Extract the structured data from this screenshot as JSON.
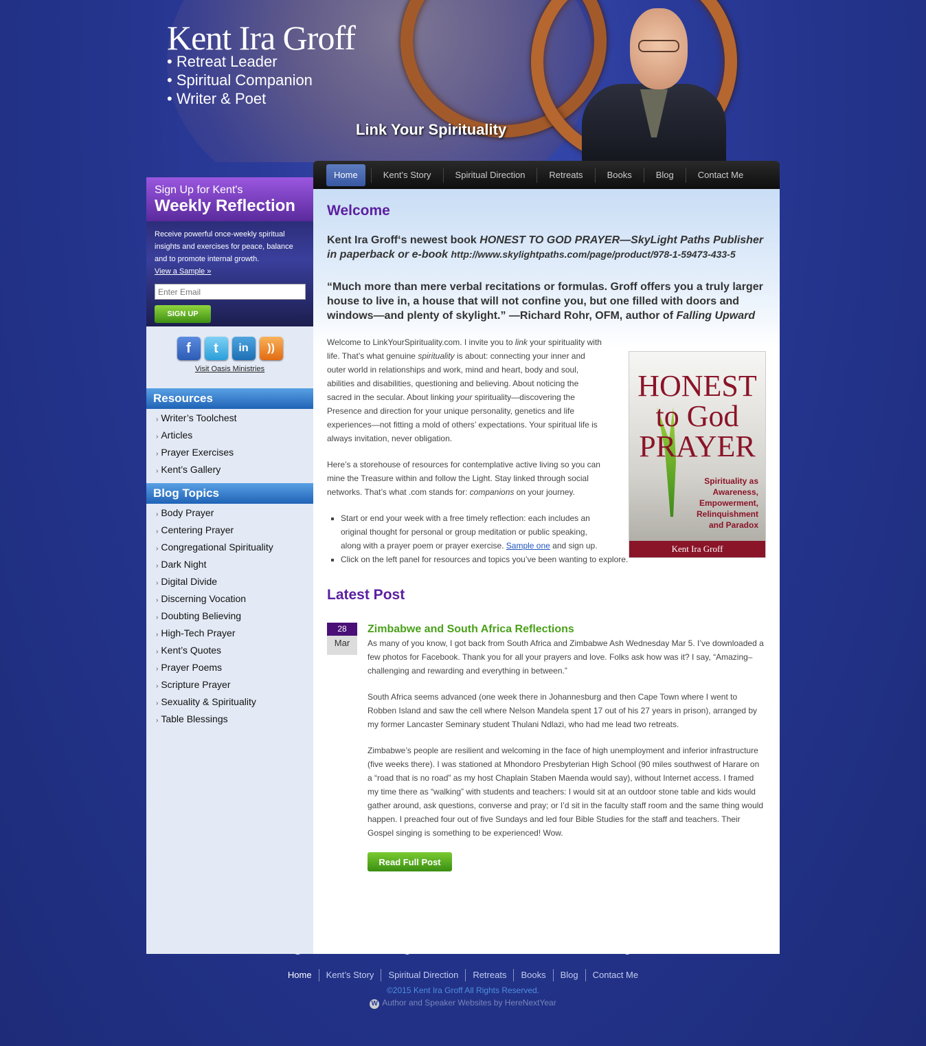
{
  "header": {
    "title": "Kent Ira Groff",
    "roles": [
      "• Retreat Leader",
      "• Spiritual Companion",
      "• Writer & Poet"
    ],
    "tagline": "Link Your Spirituality"
  },
  "nav": {
    "items": [
      "Home",
      "Kent’s Story",
      "Spiritual Direction",
      "Retreats",
      "Books",
      "Blog",
      "Contact Me"
    ],
    "active": "Home"
  },
  "signup": {
    "small": "Sign Up for Kent's",
    "big": "Weekly Reflection",
    "desc": "Receive powerful once-weekly spiritual insights and exercises for peace, balance and to promote internal growth.",
    "sample_link": "View a Sample »",
    "email_placeholder": "Enter Email",
    "button": "SIGN UP"
  },
  "social": {
    "icons": [
      "facebook-icon",
      "twitter-icon",
      "linkedin-icon",
      "rss-icon"
    ],
    "oasis_link": "Visit Oasis Ministries"
  },
  "resources": {
    "heading": "Resources",
    "items": [
      "Writer’s Toolchest",
      "Articles",
      "Prayer Exercises",
      "Kent’s Gallery"
    ]
  },
  "blog_topics": {
    "heading": "Blog Topics",
    "items": [
      "Body Prayer",
      "Centering Prayer",
      "Congregational Spirituality",
      "Dark Night",
      "Digital Divide",
      "Discerning Vocation",
      "Doubting Believing",
      "High-Tech Prayer",
      "Kent’s Quotes",
      "Prayer Poems",
      "Scripture Prayer",
      "Sexuality & Spirituality",
      "Table Blessings"
    ]
  },
  "main": {
    "welcome_heading": "Welcome",
    "intro_lead": "Kent Ira Groff‘s newest book ",
    "intro_book": "HONEST TO GOD PRAYER—SkyLight Paths Publisher in paperback or e-book ",
    "intro_url": "http://www.skylightpaths.com/page/product/978-1-59473-433-5",
    "quote_text": "“Much more than mere verbal recitations or formulas. Groff offers you a truly larger house to live in, a house that will not confine you, but one filled with doors and windows—and plenty of skylight.” —Richard Rohr, OFM, author of ",
    "quote_book": "Falling Upward",
    "para1_a": "Welcome to LinkYourSpirituality.com. I invite you to ",
    "para1_link_word": "link",
    "para1_b": " your spirituality with life. That’s what genuine ",
    "para1_spirit_word": "spirituality",
    "para1_c": " is about: connecting your inner and outer world in relationships and work, mind and heart, body and soul, abilities and disabilities, questioning and believing. About noticing the sacred in the secular. About linking ",
    "para1_your_word": "your",
    "para1_d": " spirituality—discovering the Presence and direction for your unique personality, genetics and life experiences—not fitting a mold of others’ expectations. Your spiritual life is always invitation, never obligation.",
    "para2_a": "Here’s a storehouse of resources for contemplative active living so you can mine the Treasure within and follow the Light. Stay linked through social networks. That’s what .com stands for: ",
    "para2_companions": "companions",
    "para2_b": " on your journey.",
    "bullet1_a": "Start or end your week with a free timely reflection: each includes an original thought for personal or group meditation or public speaking, along with a prayer poem or prayer exercise. ",
    "bullet1_link": "Sample one",
    "bullet1_b": " and sign up.",
    "bullet2": "Click on the left panel for resources and topics you’ve been wanting to explore."
  },
  "book_cover": {
    "title_line1": "HONEST",
    "title_line2": "to God",
    "title_line3": "PRAYER",
    "subtitle": "Spirituality as Awareness, Empowerment, Relinquishment and Paradox",
    "author": "Kent Ira Groff"
  },
  "latest": {
    "heading": "Latest Post",
    "day": "28",
    "month": "Mar",
    "title": "Zimbabwe and South Africa Reflections",
    "paragraphs": [
      "As many of you know, I got back from South Africa and Zimbabwe Ash Wednesday Mar 5. I’ve downloaded a few photos for Facebook. Thank you for all your prayers and love. Folks ask how was it? I say, “Amazing–challenging and rewarding and everything in between.”",
      "South Africa seems advanced (one week there in Johannesburg and then Cape Town where I went to Robben Island and saw the cell where Nelson Mandela spent 17 out of his 27 years in prison), arranged by my former Lancaster Seminary student Thulani Ndlazi, who had me lead two retreats.",
      "Zimbabwe’s people are resilient and welcoming in the face of high unemployment and inferior infrastructure (five weeks there). I was stationed at Mhondoro Presbyterian High School (90 miles southwest of Harare on a “road that is no road” as my host Chaplain Staben Maenda would say), without Internet access. I framed my time there as “walking” with students and teachers: I would sit at an outdoor stone table and kids would gather around, ask questions, converse and pray; or I’d sit in the faculty staff room and the same thing would happen. I preached four out of five Sundays and led four Bible Studies for the staff and teachers. Their Gospel singing is something to be experienced! Wow."
    ],
    "read_more": "Read Full Post"
  },
  "footer": {
    "nav": [
      "Home",
      "Kent’s Story",
      "Spiritual Direction",
      "Retreats",
      "Books",
      "Blog",
      "Contact Me"
    ],
    "copyright": "©2015 Kent Ira Groff All Rights Reserved.",
    "credit": "Author and Speaker Websites by HereNextYear"
  },
  "colors": {
    "background": "#2b3b9a",
    "heading_purple": "#5b1fa0",
    "post_title_green": "#4aa11a",
    "sidebar_header_blue": "#2063b6"
  }
}
